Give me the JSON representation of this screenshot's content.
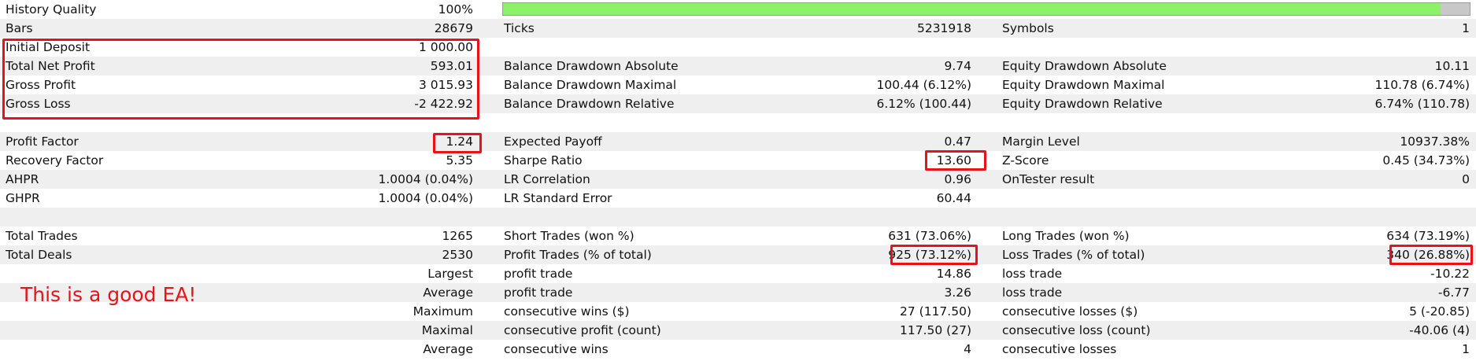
{
  "history_quality": {
    "label": "History Quality",
    "value": "100%",
    "progress_fraction": 0.97,
    "fill_color": "#8ef16a"
  },
  "summary": {
    "bars_label": "Bars",
    "bars_value": "28679",
    "ticks_label": "Ticks",
    "ticks_value": "5231918",
    "symbols_label": "Symbols",
    "symbols_value": "1"
  },
  "rows": [
    {
      "c1": {
        "label": "Initial Deposit",
        "value": "1 000.00"
      },
      "c2": {
        "label": "",
        "value": ""
      },
      "c3": {
        "label": "",
        "value": ""
      }
    },
    {
      "c1": {
        "label": "Total Net Profit",
        "value": "593.01"
      },
      "c2": {
        "label": "Balance Drawdown Absolute",
        "value": "9.74"
      },
      "c3": {
        "label": "Equity Drawdown Absolute",
        "value": "10.11"
      }
    },
    {
      "c1": {
        "label": "Gross Profit",
        "value": "3 015.93"
      },
      "c2": {
        "label": "Balance Drawdown Maximal",
        "value": "100.44 (6.12%)"
      },
      "c3": {
        "label": "Equity Drawdown Maximal",
        "value": "110.78 (6.74%)"
      }
    },
    {
      "c1": {
        "label": "Gross Loss",
        "value": "-2 422.92"
      },
      "c2": {
        "label": "Balance Drawdown Relative",
        "value": "6.12% (100.44)"
      },
      "c3": {
        "label": "Equity Drawdown Relative",
        "value": "6.74% (110.78)"
      }
    },
    {
      "c1": {
        "label": "",
        "value": ""
      },
      "c2": {
        "label": "",
        "value": ""
      },
      "c3": {
        "label": "",
        "value": ""
      }
    },
    {
      "c1": {
        "label": "Profit Factor",
        "value": "1.24"
      },
      "c2": {
        "label": "Expected Payoff",
        "value": "0.47"
      },
      "c3": {
        "label": "Margin Level",
        "value": "10937.38%"
      }
    },
    {
      "c1": {
        "label": "Recovery Factor",
        "value": "5.35"
      },
      "c2": {
        "label": "Sharpe Ratio",
        "value": "13.60"
      },
      "c3": {
        "label": "Z-Score",
        "value": "0.45 (34.73%)"
      }
    },
    {
      "c1": {
        "label": "AHPR",
        "value": "1.0004 (0.04%)"
      },
      "c2": {
        "label": "LR Correlation",
        "value": "0.96"
      },
      "c3": {
        "label": "OnTester result",
        "value": "0"
      }
    },
    {
      "c1": {
        "label": "GHPR",
        "value": "1.0004 (0.04%)"
      },
      "c2": {
        "label": "LR Standard Error",
        "value": "60.44"
      },
      "c3": {
        "label": "",
        "value": ""
      }
    },
    {
      "c1": {
        "label": "",
        "value": ""
      },
      "c2": {
        "label": "",
        "value": ""
      },
      "c3": {
        "label": "",
        "value": ""
      }
    },
    {
      "c1": {
        "label": "Total Trades",
        "value": "1265"
      },
      "c2": {
        "label": "Short Trades (won %)",
        "value": "631 (73.06%)"
      },
      "c3": {
        "label": "Long Trades (won %)",
        "value": "634 (73.19%)"
      }
    },
    {
      "c1": {
        "label": "Total Deals",
        "value": "2530"
      },
      "c2": {
        "label": "Profit Trades (% of total)",
        "value": "925 (73.12%)"
      },
      "c3": {
        "label": "Loss Trades (% of total)",
        "value": "340 (26.88%)"
      }
    },
    {
      "c1": {
        "label": "",
        "value": "Largest"
      },
      "c2": {
        "label": "profit trade",
        "value": "14.86"
      },
      "c3": {
        "label": "loss trade",
        "value": "-10.22"
      }
    },
    {
      "c1": {
        "label": "",
        "value": "Average"
      },
      "c2": {
        "label": "profit trade",
        "value": "3.26"
      },
      "c3": {
        "label": "loss trade",
        "value": "-6.77"
      }
    },
    {
      "c1": {
        "label": "",
        "value": "Maximum"
      },
      "c2": {
        "label": "consecutive wins ($)",
        "value": "27 (117.50)"
      },
      "c3": {
        "label": "consecutive losses ($)",
        "value": "5 (-20.85)"
      }
    },
    {
      "c1": {
        "label": "",
        "value": "Maximal"
      },
      "c2": {
        "label": "consecutive profit (count)",
        "value": "117.50 (27)"
      },
      "c3": {
        "label": "consecutive loss (count)",
        "value": "-40.06 (4)"
      }
    },
    {
      "c1": {
        "label": "",
        "value": "Average"
      },
      "c2": {
        "label": "consecutive wins",
        "value": "4"
      },
      "c3": {
        "label": "consecutive losses",
        "value": "1"
      }
    }
  ],
  "annotation": {
    "text": "This is a good EA!",
    "color": "#e8131a"
  },
  "colors": {
    "row_shade": "#efefef",
    "highlight": "#e8131a",
    "bar_track": "#c8c8c8"
  }
}
